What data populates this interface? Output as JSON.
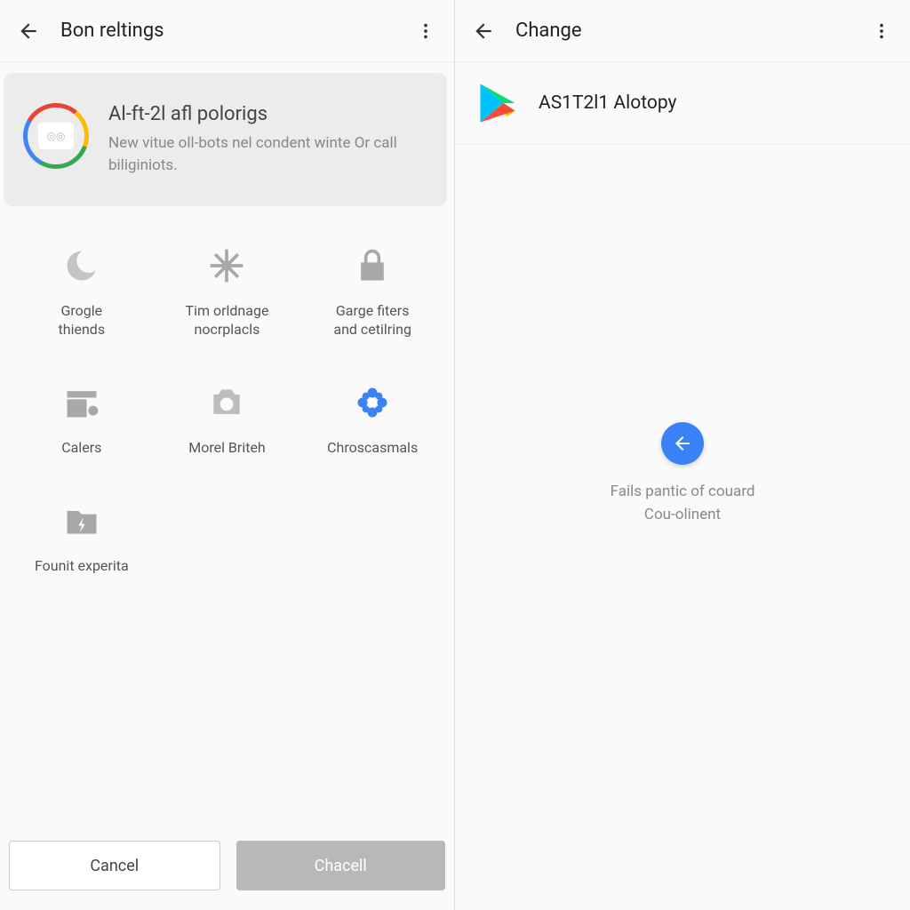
{
  "left": {
    "appbar": {
      "title": "Bon reltings",
      "back_desc": "Back",
      "menu_desc": "More options"
    },
    "hero": {
      "title": "Al-ft-2l afl polorigs",
      "subtitle": "New vitue oll-bots nel condent winte Or call biliginiots."
    },
    "grid": [
      {
        "label": "Grogle\nthiends"
      },
      {
        "label": "Tim orldnage\nnocrplacls"
      },
      {
        "label": "Garge fiters\nand cetilring"
      },
      {
        "label": "Calers"
      },
      {
        "label": "Morel Briteh"
      },
      {
        "label": "Chroscasmals"
      },
      {
        "label": "Founit experita"
      }
    ],
    "footer": {
      "cancel": "Cancel",
      "confirm": "Chacell"
    }
  },
  "right": {
    "appbar": {
      "title": "Change",
      "back_desc": "Back",
      "menu_desc": "More options"
    },
    "app": {
      "name": "AS1T2l1 Alotopy"
    },
    "empty": {
      "line1": "Fails pantic of couard",
      "line2": "Cou-olinent"
    }
  }
}
